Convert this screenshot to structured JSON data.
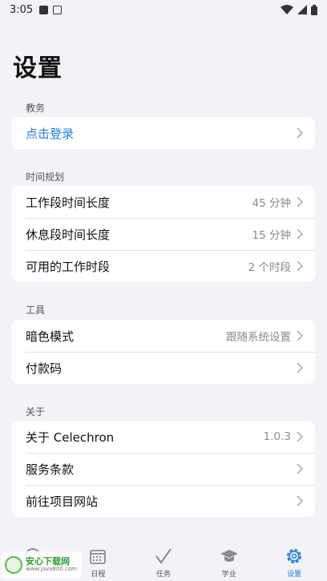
{
  "status_bar": {
    "time": "3:05"
  },
  "page": {
    "title": "设置"
  },
  "sections": {
    "academic": {
      "header": "教务",
      "rows": [
        {
          "label": "点击登录",
          "value": ""
        }
      ]
    },
    "time_planning": {
      "header": "时间规划",
      "rows": [
        {
          "label": "工作段时间长度",
          "value": "45 分钟"
        },
        {
          "label": "休息段时间长度",
          "value": "15 分钟"
        },
        {
          "label": "可用的工作时段",
          "value": "2 个时段"
        }
      ]
    },
    "tools": {
      "header": "工具",
      "rows": [
        {
          "label": "暗色模式",
          "value": "跟随系统设置"
        },
        {
          "label": "付款码",
          "value": ""
        }
      ]
    },
    "about": {
      "header": "关于",
      "rows": [
        {
          "label": "关于 Celechron",
          "value": "1.0.3"
        },
        {
          "label": "服务条款",
          "value": ""
        },
        {
          "label": "前往项目网站",
          "value": ""
        }
      ]
    }
  },
  "bottom_nav": {
    "items": [
      {
        "label": "",
        "icon": "overview-icon"
      },
      {
        "label": "日程",
        "icon": "calendar-icon"
      },
      {
        "label": "任务",
        "icon": "checkmark-icon"
      },
      {
        "label": "学业",
        "icon": "graduation-cap-icon"
      },
      {
        "label": "设置",
        "icon": "gear-icon",
        "active": true
      }
    ]
  },
  "watermark": {
    "main": "安心下载网",
    "sub": "www.java800.com"
  },
  "colors": {
    "accent": "#1e7fd8",
    "background": "#f2f2f7",
    "card": "#ffffff",
    "secondary_text": "#8a8a8e"
  }
}
